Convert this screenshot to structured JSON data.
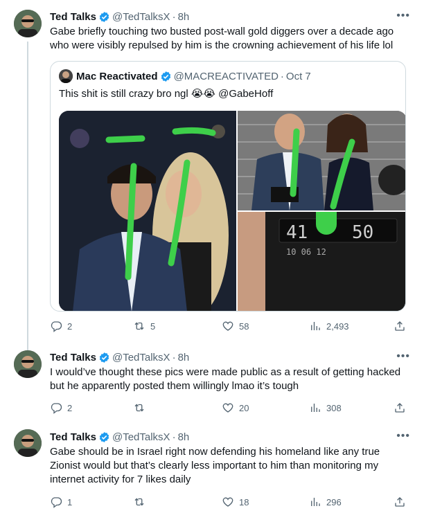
{
  "tweets": [
    {
      "name": "Ted Talks",
      "handle": "@TedTalksX",
      "time": "8h",
      "text": "Gabe briefly touching two busted post-wall gold diggers over a decade ago who were visibly repulsed by him is the crowning achievement of his life lol",
      "quote": {
        "name": "Mac Reactivated",
        "handle": "@MACREACTIVATED",
        "time": "Oct 7",
        "text": "This shit is still crazy bro ngl 😭😭 @GabeHoff"
      },
      "stats": {
        "replies": "2",
        "retweets": "5",
        "likes": "58",
        "views": "2,493"
      }
    },
    {
      "name": "Ted Talks",
      "handle": "@TedTalksX",
      "time": "8h",
      "text": "I would’ve thought these pics were made public as a result of getting hacked but he apparently posted them willingly lmao it’s tough",
      "stats": {
        "replies": "2",
        "retweets": "",
        "likes": "20",
        "views": "308"
      }
    },
    {
      "name": "Ted Talks",
      "handle": "@TedTalksX",
      "time": "8h",
      "text": "Gabe should be in Israel right now defending his homeland like any true Zionist would but that’s clearly less important to him than monitoring my internet activity for 7 likes daily",
      "stats": {
        "replies": "1",
        "retweets": "",
        "likes": "18",
        "views": "296"
      }
    }
  ],
  "colors": {
    "verified": "#1d9bf0",
    "muted": "#536471",
    "annotation_green": "#3ecf4a"
  },
  "icons": [
    "verified-badge-icon",
    "reply-icon",
    "retweet-icon",
    "like-icon",
    "views-icon",
    "share-icon",
    "more-icon"
  ]
}
